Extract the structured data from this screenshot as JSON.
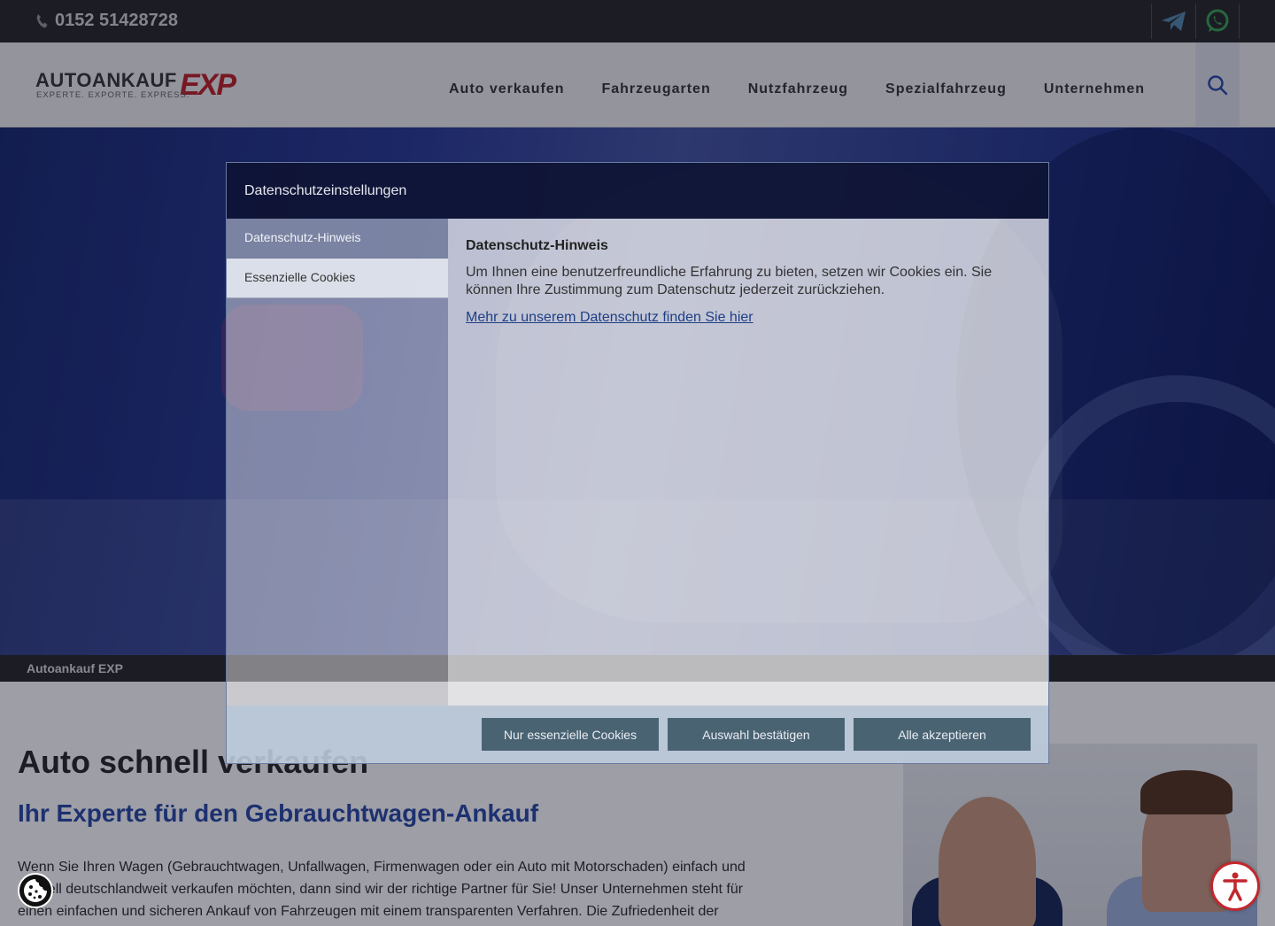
{
  "topbar": {
    "phone": "0152 51428728",
    "icons": [
      "telegram-icon",
      "whatsapp-icon"
    ]
  },
  "header": {
    "logo_text": "AUTOANKAUF",
    "logo_exp": "EXP",
    "logo_tagline": "EXPERTE. EXPORTE. EXPRESS.",
    "nav": [
      "Auto verkaufen",
      "Fahrzeugarten",
      "Nutzfahrzeug",
      "Spezialfahrzeug",
      "Unternehmen"
    ]
  },
  "breadcrumb": "Autoankauf EXP",
  "main": {
    "h1": "Auto schnell verkaufen",
    "h2": "Ihr Experte für den Gebrauchtwagen-Ankauf",
    "paragraph": "Wenn Sie Ihren Wagen (Gebrauchtwagen, Unfallwagen, Firmenwagen oder ein Auto mit Motorschaden) einfach und schnell deutschlandweit verkaufen möchten, dann sind wir der richtige Partner für Sie! Unser Unternehmen steht für einen einfachen und sicheren Ankauf von Fahrzeugen mit einem transparenten Verfahren. Die Zufriedenheit der"
  },
  "modal": {
    "title": "Datenschutzeinstellungen",
    "tabs": [
      "Datenschutz-Hinweis",
      "Essenzielle Cookies"
    ],
    "content_title": "Datenschutz-Hinweis",
    "content_text": "Um Ihnen eine benutzerfreundliche Erfahrung zu bieten, setzen wir Cookies ein. Sie können Ihre Zustimmung zum Datenschutz jederzeit zurückziehen.",
    "content_link": "Mehr zu unserem Datenschutz finden Sie hier",
    "buttons": {
      "essential": "Nur essenzielle Cookies",
      "confirm": "Auswahl bestätigen",
      "accept_all": "Alle akzeptieren"
    }
  },
  "colors": {
    "brand_red": "#c1272d",
    "heading_blue": "#2f4fa8",
    "button": "#4a6373"
  }
}
